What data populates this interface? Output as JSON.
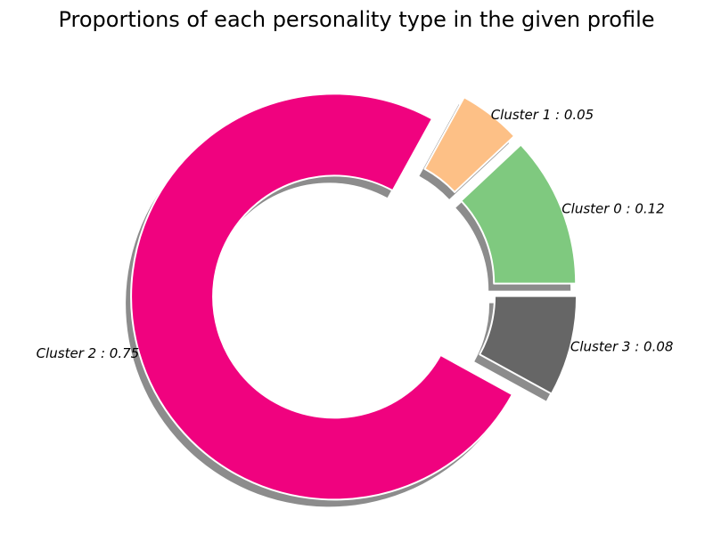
{
  "chart_data": {
    "type": "pie",
    "title": "Proportions of each personality type in the given profile",
    "donut": true,
    "shadow": true,
    "exploded": true,
    "slices": [
      {
        "name": "Cluster 0",
        "value": 0.12,
        "label": "Cluster 0 : 0.12",
        "color": "#7fc97f"
      },
      {
        "name": "Cluster 1",
        "value": 0.05,
        "label": "Cluster 1 : 0.05",
        "color": "#fdc086"
      },
      {
        "name": "Cluster 2",
        "value": 0.75,
        "label": "Cluster 2 : 0.75",
        "color": "#f0027f"
      },
      {
        "name": "Cluster 3",
        "value": 0.08,
        "label": "Cluster 3 : 0.08",
        "color": "#666666"
      }
    ]
  }
}
